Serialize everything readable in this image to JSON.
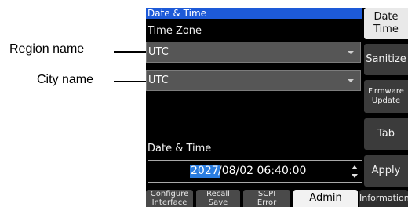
{
  "callouts": {
    "region": "Region name",
    "city": "City name"
  },
  "header": {
    "title": "Date & Time"
  },
  "timezone": {
    "label": "Time Zone",
    "region_value": "UTC",
    "city_value": "UTC"
  },
  "datetime": {
    "label": "Date & Time",
    "selected_part": "2027",
    "rest": "/08/02 06:40:00"
  },
  "side_buttons": [
    {
      "label": "Date\nTime",
      "active": true
    },
    {
      "label": "Sanitize",
      "active": false
    },
    {
      "label": "Firmware\nUpdate",
      "active": false
    },
    {
      "label": "Tab",
      "active": false
    },
    {
      "label": "Apply",
      "active": false
    }
  ],
  "tabs": [
    {
      "label": "Configure\nInterface"
    },
    {
      "label": "Recall\nSave"
    },
    {
      "label": "SCPI\nError"
    },
    {
      "label": "Admin"
    },
    {
      "label": "Information"
    }
  ],
  "colors": {
    "title_bar": "#1d5ad8",
    "selection": "#2a7de0",
    "dropdown": "#565656"
  }
}
